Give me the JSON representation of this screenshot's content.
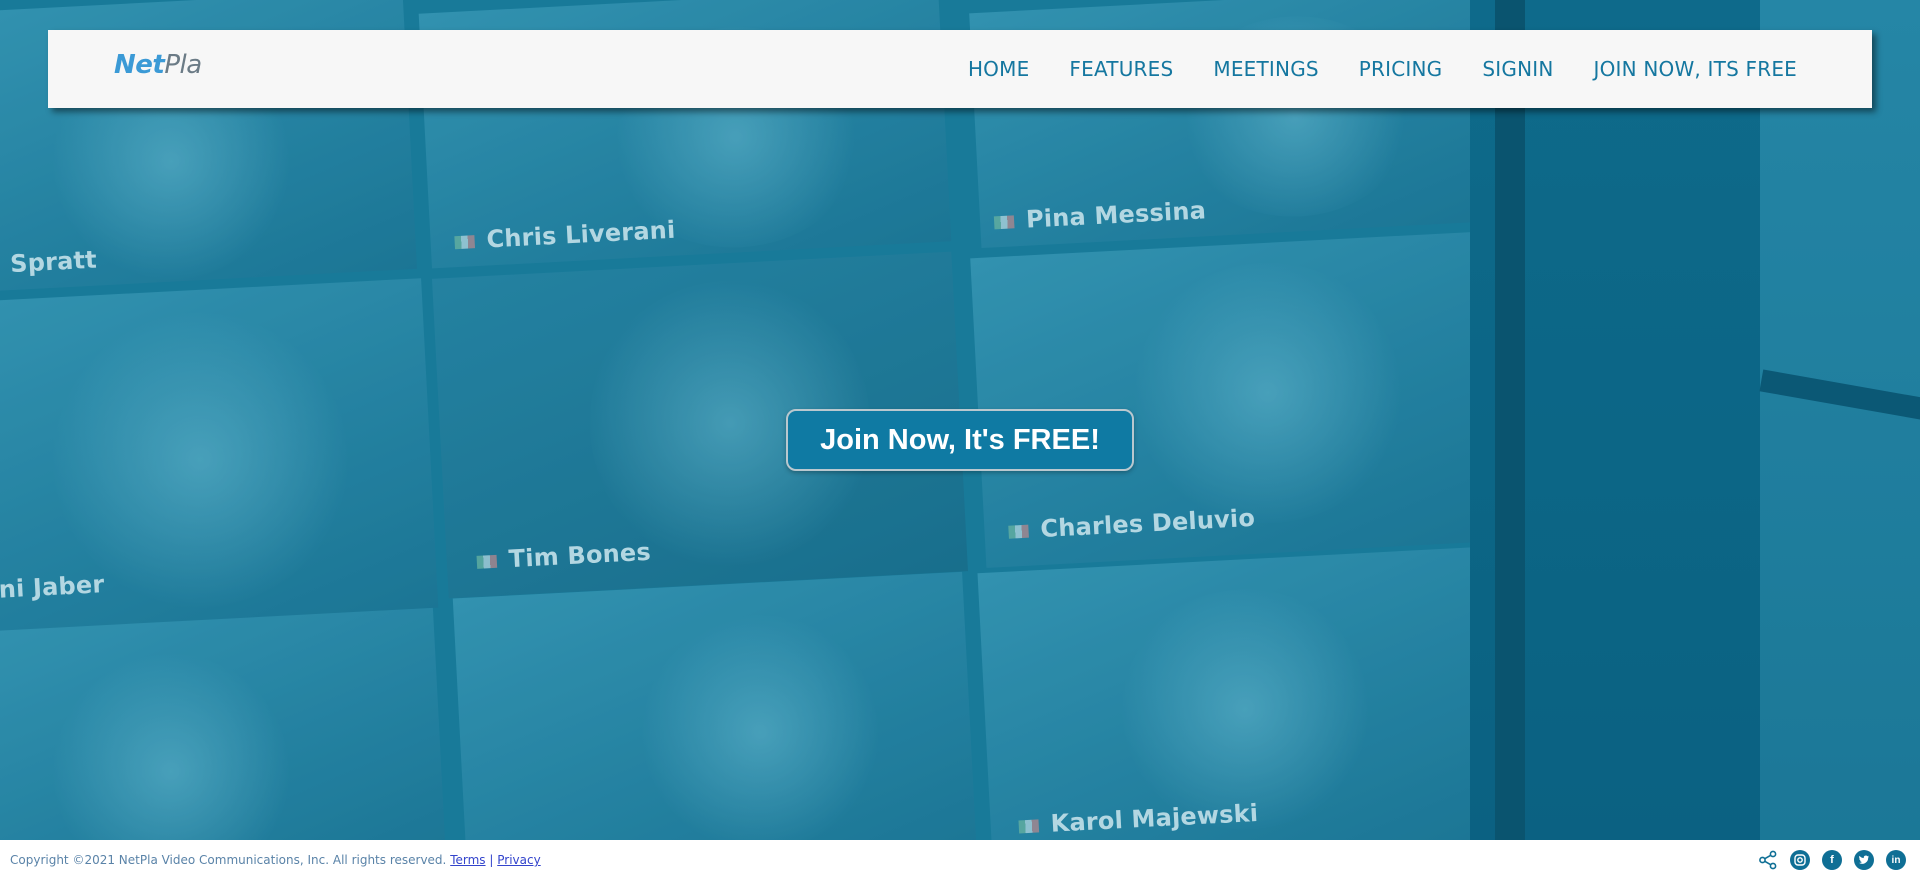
{
  "brand": {
    "logo_part1": "Net",
    "logo_part2": "Pla"
  },
  "nav": {
    "items": [
      {
        "label": "HOME"
      },
      {
        "label": "FEATURES"
      },
      {
        "label": "MEETINGS"
      },
      {
        "label": "PRICING"
      },
      {
        "label": "SIGNIN"
      },
      {
        "label": "JOIN NOW, ITS FREE"
      }
    ]
  },
  "hero": {
    "cta_label": "Join Now, It's FREE!",
    "participants": [
      {
        "name": "Spratt"
      },
      {
        "name": "Chris Liverani"
      },
      {
        "name": "Pina Messina"
      },
      {
        "name": "ni Jaber"
      },
      {
        "name": "Tim Bones"
      },
      {
        "name": "Charles Deluvio"
      },
      {
        "name": "Karol Majewski"
      }
    ]
  },
  "footer": {
    "copyright": "Copyright ©2021 NetPla Video Communications, Inc. All rights reserved.",
    "terms_label": "Terms",
    "separator": "|",
    "privacy_label": "Privacy"
  },
  "social": {
    "icons": [
      "share-icon",
      "instagram-icon",
      "facebook-icon",
      "twitter-icon",
      "linkedin-icon"
    ]
  },
  "colors": {
    "accent": "#1577a0",
    "cta_background": "#0f7aa3",
    "navbar_background": "#f7f7f7",
    "hero_tint": "#1b7d9c"
  }
}
